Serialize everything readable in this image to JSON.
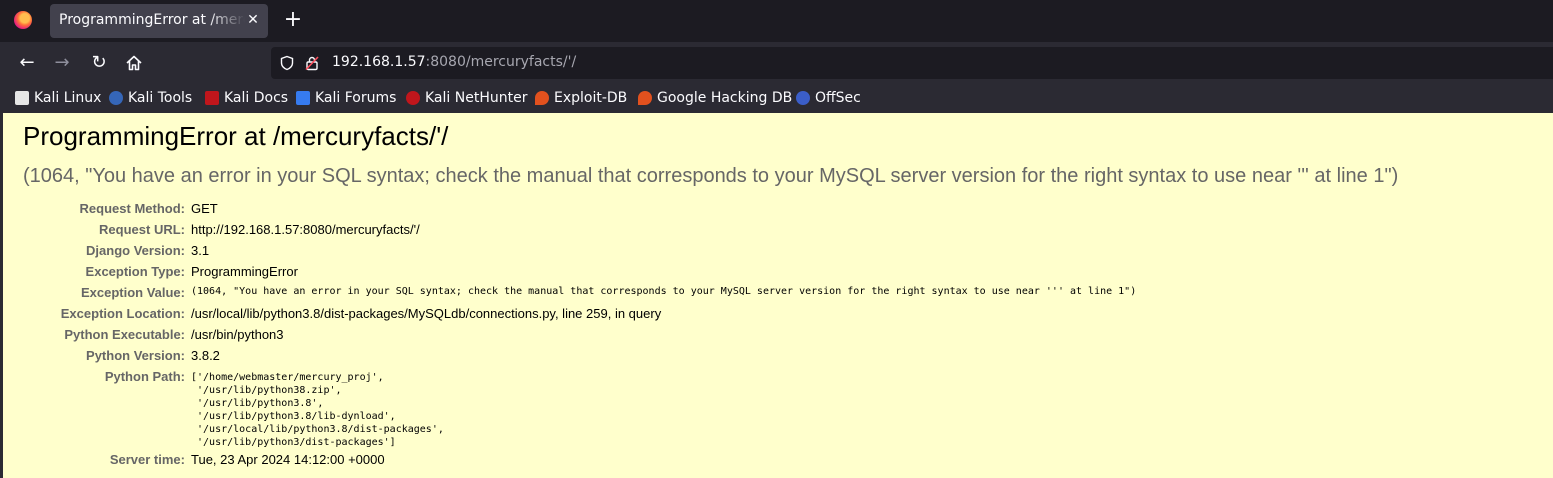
{
  "browser": {
    "tab_title": "ProgrammingError at /mercuryfacts/'/",
    "url_host": "192.168.1.57",
    "url_rest": ":8080/mercuryfacts/'/",
    "bookmarks": [
      {
        "label": "Kali Linux",
        "icon": "kali-linux-icon",
        "color": "#1e1e1e"
      },
      {
        "label": "Kali Tools",
        "icon": "kali-tools-icon",
        "color": "#3566b8"
      },
      {
        "label": "Kali Docs",
        "icon": "kali-docs-icon",
        "color": "#c0161c"
      },
      {
        "label": "Kali Forums",
        "icon": "kali-forums-icon",
        "color": "#367bf0"
      },
      {
        "label": "Kali NetHunter",
        "icon": "kali-nethunter-icon",
        "color": "#c0161c"
      },
      {
        "label": "Exploit-DB",
        "icon": "exploit-db-icon",
        "color": "#e2511e"
      },
      {
        "label": "Google Hacking DB",
        "icon": "google-hacking-db-icon",
        "color": "#e2511e"
      },
      {
        "label": "OffSec",
        "icon": "offsec-icon",
        "color": "#3b5ec9"
      }
    ]
  },
  "error": {
    "title": "ProgrammingError at /mercuryfacts/'/",
    "exception_value": "(1064, \"You have an error in your SQL syntax; check the manual that corresponds to your MySQL server version for the right syntax to use near ''' at line 1\")",
    "fields": {
      "request_method": {
        "label": "Request Method:",
        "value": "GET"
      },
      "request_url": {
        "label": "Request URL:",
        "value": "http://192.168.1.57:8080/mercuryfacts/'/"
      },
      "django_version": {
        "label": "Django Version:",
        "value": "3.1"
      },
      "exception_type": {
        "label": "Exception Type:",
        "value": "ProgrammingError"
      },
      "exception_value": {
        "label": "Exception Value:",
        "value": "(1064, \"You have an error in your SQL syntax; check the manual that corresponds to your MySQL server version for the right syntax to use near ''' at line 1\")"
      },
      "exception_location": {
        "label": "Exception Location:",
        "value": "/usr/local/lib/python3.8/dist-packages/MySQLdb/connections.py, line 259, in query"
      },
      "python_executable": {
        "label": "Python Executable:",
        "value": "/usr/bin/python3"
      },
      "python_version": {
        "label": "Python Version:",
        "value": "3.8.2"
      },
      "python_path": {
        "label": "Python Path:"
      },
      "server_time": {
        "label": "Server time:",
        "value": "Tue, 23 Apr 2024 14:12:00 +0000"
      }
    },
    "python_path_lines": [
      "['/home/webmaster/mercury_proj',",
      " '/usr/lib/python38.zip',",
      " '/usr/lib/python3.8',",
      " '/usr/lib/python3.8/lib-dynload',",
      " '/usr/local/lib/python3.8/dist-packages',",
      " '/usr/lib/python3/dist-packages']"
    ]
  }
}
